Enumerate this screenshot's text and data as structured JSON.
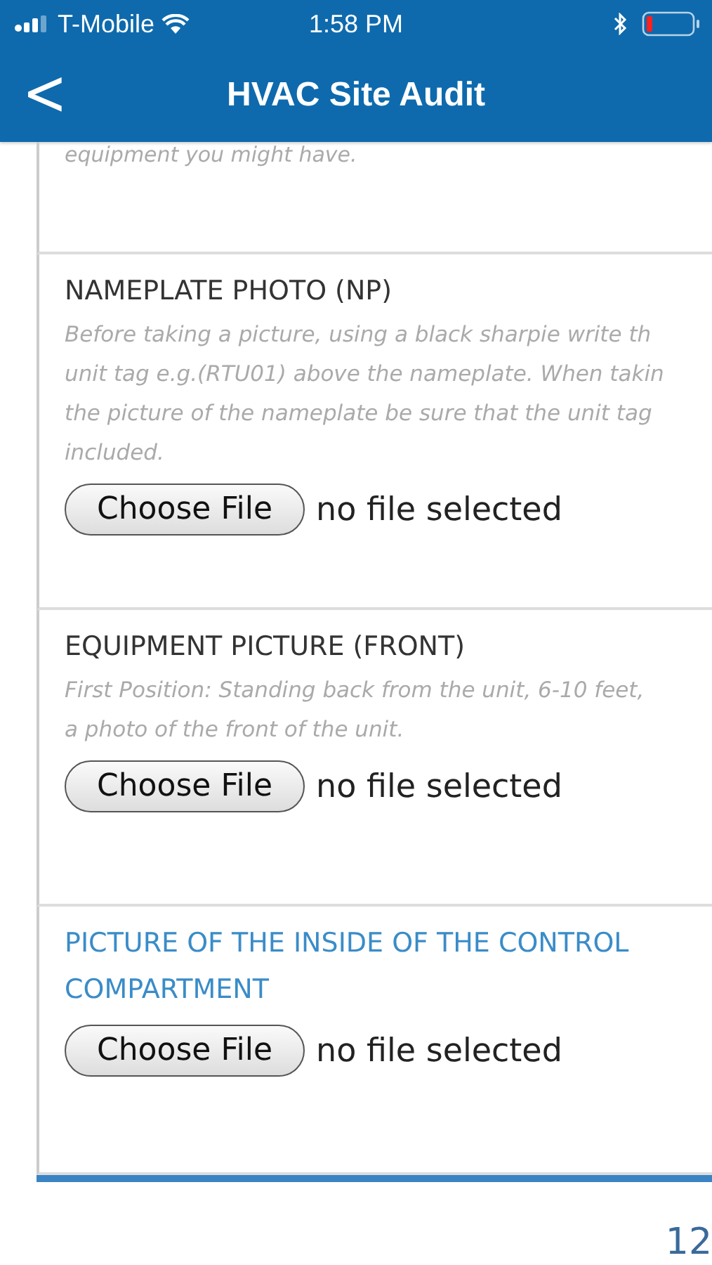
{
  "status_bar": {
    "carrier": "T-Mobile",
    "time": "1:58 PM"
  },
  "header": {
    "back_icon": "<",
    "title": "HVAC Site Audit"
  },
  "cut_text": "equipment you might have.",
  "sections": [
    {
      "title": "NAMEPLATE PHOTO (NP)",
      "highlighted": false,
      "description_lines": [
        "Before taking a picture, using a black sharpie write th",
        "unit tag e.g.(RTU01) above the nameplate. When takin",
        "the picture of the nameplate be sure that the unit tag",
        "included."
      ],
      "button": "Choose File",
      "file_status": "no file selected"
    },
    {
      "title": "EQUIPMENT PICTURE (FRONT)",
      "highlighted": false,
      "description_lines": [
        "First Position: Standing back from the unit, 6-10 feet,",
        "a photo of the front of the unit."
      ],
      "button": "Choose File",
      "file_status": "no file selected"
    },
    {
      "title": "PICTURE OF THE INSIDE OF THE CONTROL COMPARTMENT",
      "highlighted": true,
      "button": "Choose File",
      "file_status": "no file selected"
    }
  ],
  "page_number": "12"
}
